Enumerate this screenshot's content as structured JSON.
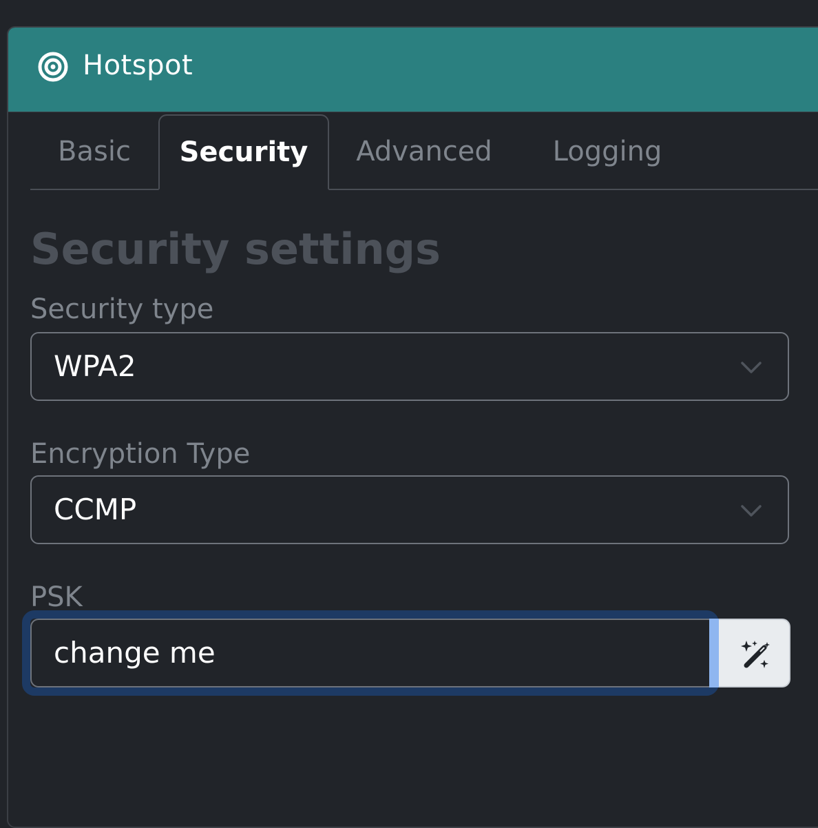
{
  "header": {
    "title": "Hotspot",
    "icon": "target-icon",
    "background_color": "#2b8080"
  },
  "tabs": [
    {
      "label": "Basic",
      "active": false
    },
    {
      "label": "Security",
      "active": true
    },
    {
      "label": "Advanced",
      "active": false
    },
    {
      "label": "Logging",
      "active": false
    }
  ],
  "section": {
    "title": "Security settings"
  },
  "fields": {
    "security_type": {
      "label": "Security type",
      "value": "WPA2",
      "icon": "chevron-down-icon"
    },
    "encryption_type": {
      "label": "Encryption Type",
      "value": "CCMP",
      "icon": "chevron-down-icon"
    },
    "psk": {
      "label": "PSK",
      "value": "change me",
      "focused": true,
      "generate_button_icon": "magic-wand-icon"
    }
  }
}
